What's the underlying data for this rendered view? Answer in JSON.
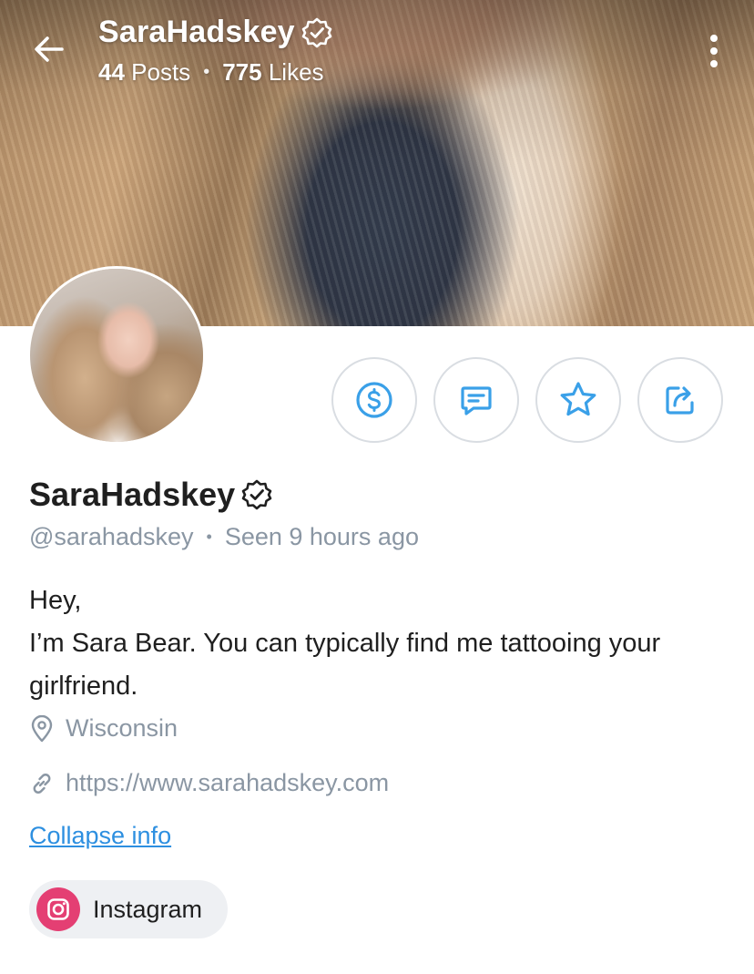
{
  "header": {
    "title": "SaraHadskey",
    "posts_count": "44",
    "posts_label": "Posts",
    "likes_count": "775",
    "likes_label": "Likes",
    "separator": "•"
  },
  "profile": {
    "display_name": "SaraHadskey",
    "handle": "@sarahadskey",
    "separator": "•",
    "last_seen": "Seen 9 hours ago",
    "bio_line1": "Hey,",
    "bio_line2": "I’m Sara Bear. You can typically find me tattooing your girlfriend.",
    "location": "Wisconsin",
    "website": "https://www.sarahadskey.com",
    "collapse_label": "Collapse info"
  },
  "social": {
    "instagram_label": "Instagram"
  },
  "icons": {
    "back": "arrow-left-icon",
    "verified": "verified-badge-icon",
    "more": "more-vertical-icon",
    "tip": "dollar-icon",
    "message": "message-icon",
    "favorite": "star-icon",
    "share": "share-icon",
    "location": "location-pin-icon",
    "link": "link-icon",
    "instagram": "instagram-icon"
  },
  "colors": {
    "accent": "#2d8fe0",
    "action_icon": "#3aa0e8",
    "muted_text": "#8a96a3",
    "instagram": "#e43f73"
  }
}
